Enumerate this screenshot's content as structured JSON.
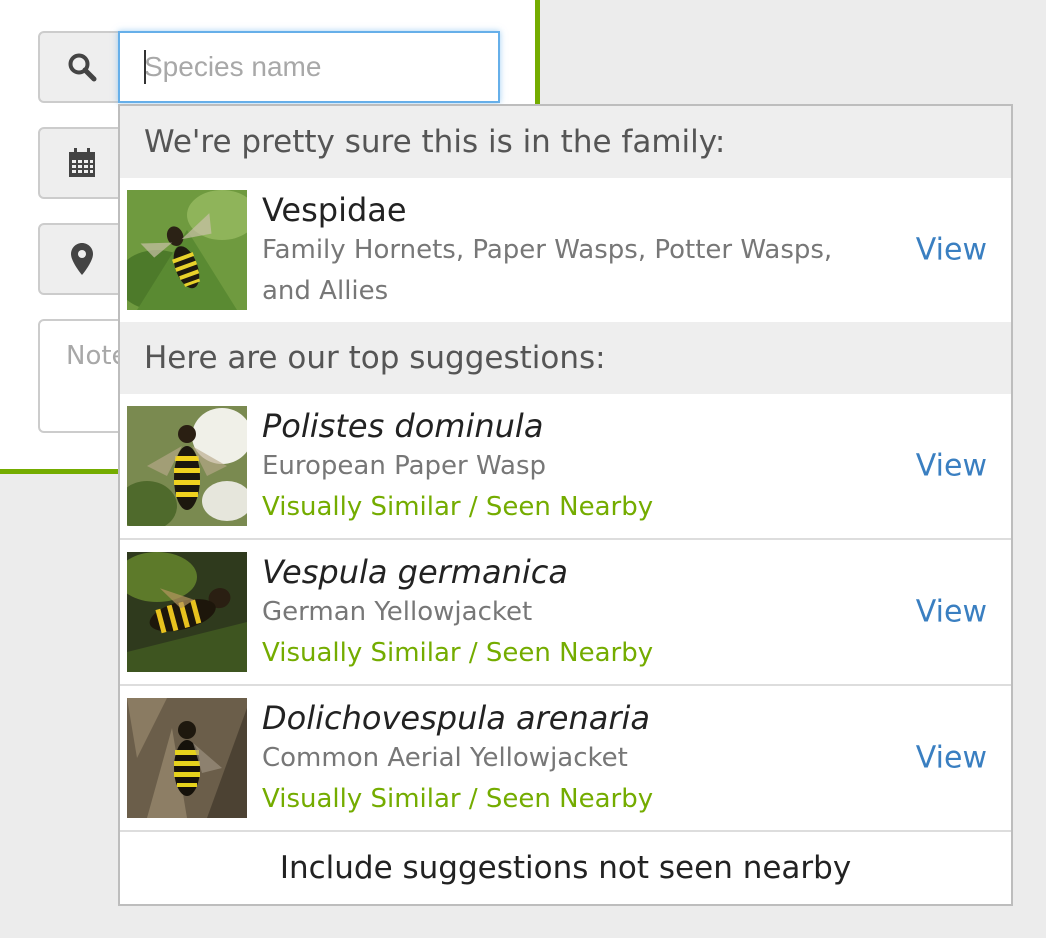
{
  "form": {
    "search_placeholder": "Species name",
    "search_value": "",
    "notes_placeholder": "Note"
  },
  "dropdown": {
    "family_header": "We're pretty sure this is in the family:",
    "family": {
      "name": "Vespidae",
      "common": "Family Hornets, Paper Wasps, Potter Wasps, and Allies",
      "view_label": "View"
    },
    "suggestions_header": "Here are our top suggestions:",
    "suggestions": [
      {
        "name": "Polistes dominula",
        "common": "European Paper Wasp",
        "reason": "Visually Similar / Seen Nearby",
        "view_label": "View"
      },
      {
        "name": "Vespula germanica",
        "common": "German Yellowjacket",
        "reason": "Visually Similar / Seen Nearby",
        "view_label": "View"
      },
      {
        "name": "Dolichovespula arenaria",
        "common": "Common Aerial Yellowjacket",
        "reason": "Visually Similar / Seen Nearby",
        "view_label": "View"
      }
    ],
    "footer_label": "Include suggestions not seen nearby"
  },
  "colors": {
    "accent_green": "#74ac00",
    "link_blue": "#3a7fc1",
    "focus_blue": "#66afe9"
  },
  "icons": {
    "search": "search-icon",
    "date": "calendar-icon",
    "location": "map-marker-icon"
  }
}
